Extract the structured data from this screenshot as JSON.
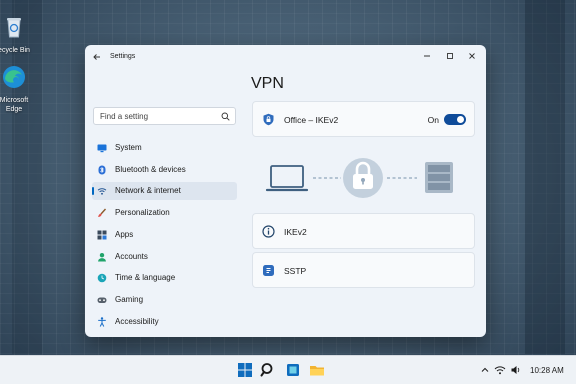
{
  "desktop": {
    "icons": [
      {
        "label": "ecycle Bin"
      },
      {
        "label_line1": "Microsoft",
        "label_line2": "Edge"
      }
    ]
  },
  "window": {
    "title": "Settings",
    "search": {
      "placeholder": "Find a setting",
      "value": ""
    },
    "nav": [
      {
        "label": "System",
        "icon": "monitor-icon"
      },
      {
        "label": "Bluetooth & devices",
        "icon": "bluetooth-icon"
      },
      {
        "label": "Network & internet",
        "icon": "wifi-icon",
        "active": true
      },
      {
        "label": "Personalization",
        "icon": "brush-icon"
      },
      {
        "label": "Apps",
        "icon": "apps-icon"
      },
      {
        "label": "Accounts",
        "icon": "account-icon"
      },
      {
        "label": "Time & language",
        "icon": "globe-clock-icon"
      },
      {
        "label": "Gaming",
        "icon": "gamepad-icon"
      },
      {
        "label": "Accessibility",
        "icon": "accessibility-icon"
      }
    ],
    "page_title": "VPN",
    "vpn_connection": {
      "name": "Office – IKEv2",
      "status": "On",
      "enabled": true
    },
    "vpn_types": [
      {
        "label": "IKEv2",
        "icon": "info-icon"
      },
      {
        "label": "SSTP",
        "icon": "ssl-shield-icon"
      }
    ]
  },
  "taskbar": {
    "clock": "10:28 AM",
    "accent": "#0067c0"
  }
}
